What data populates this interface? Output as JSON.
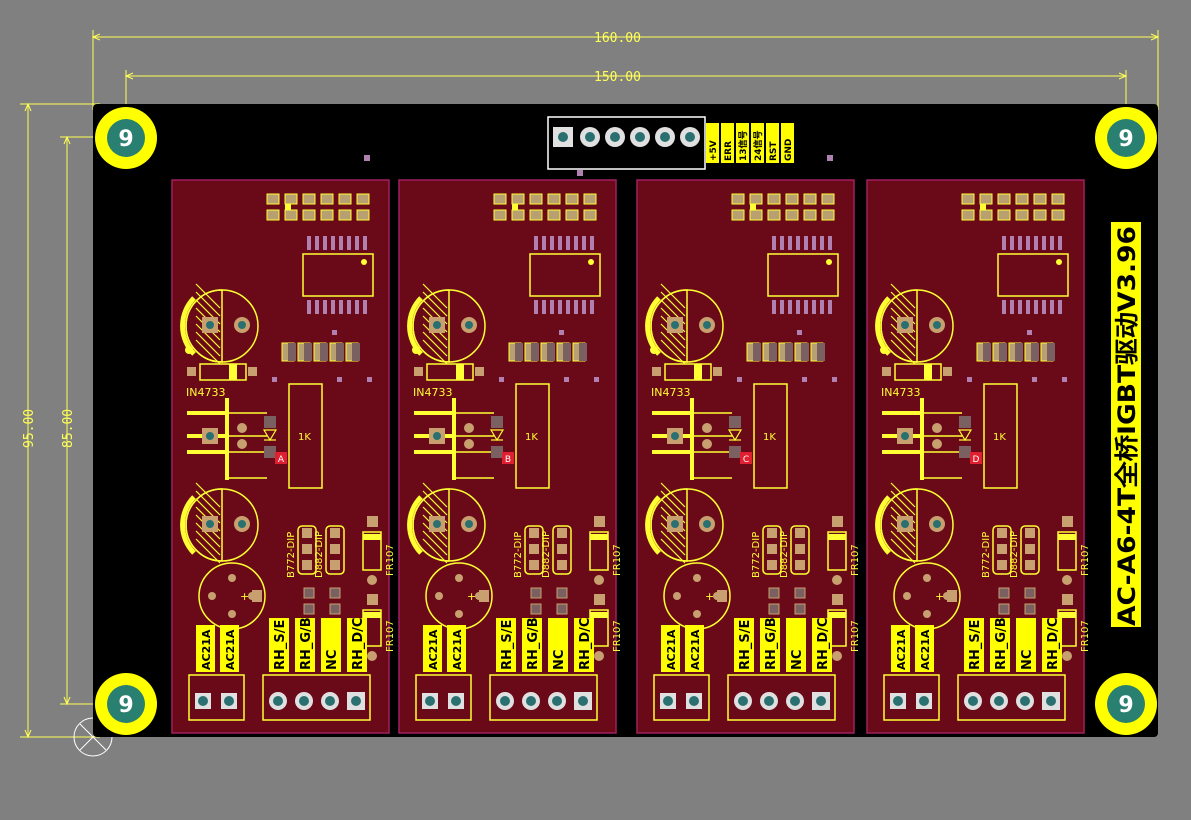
{
  "dimensions": {
    "outer_width": "160.00",
    "inner_width": "150.00",
    "outer_height": "95.00",
    "inner_height": "85.00"
  },
  "board": {
    "title": "AC-A6-4T全桥IGBT驱动V3.96",
    "mount_hole_label": "9",
    "header_pins": [
      "+5V",
      "ERR",
      "13信号",
      "24信号",
      "RST",
      "GND"
    ]
  },
  "modules": [
    {
      "letter": "A"
    },
    {
      "letter": "B"
    },
    {
      "letter": "C"
    },
    {
      "letter": "D"
    }
  ],
  "module_labels": {
    "zener": "IN4733",
    "resistor": "1K",
    "transistor_pnp": "B772-DIP",
    "transistor_npn": "D882-DIP",
    "diode": "FR107",
    "ac1": "AC21A",
    "ac2": "AC21A",
    "out1": "RH_S/E",
    "out2": "RH_G/B",
    "out3": "NC",
    "out4": "RH_D/C"
  },
  "colors": {
    "background": "#808080",
    "board": "#000000",
    "module_fill": "#6a0a18",
    "silkscreen": "#ffff33",
    "pad": "#c8a070",
    "hole": "#2a7070"
  }
}
